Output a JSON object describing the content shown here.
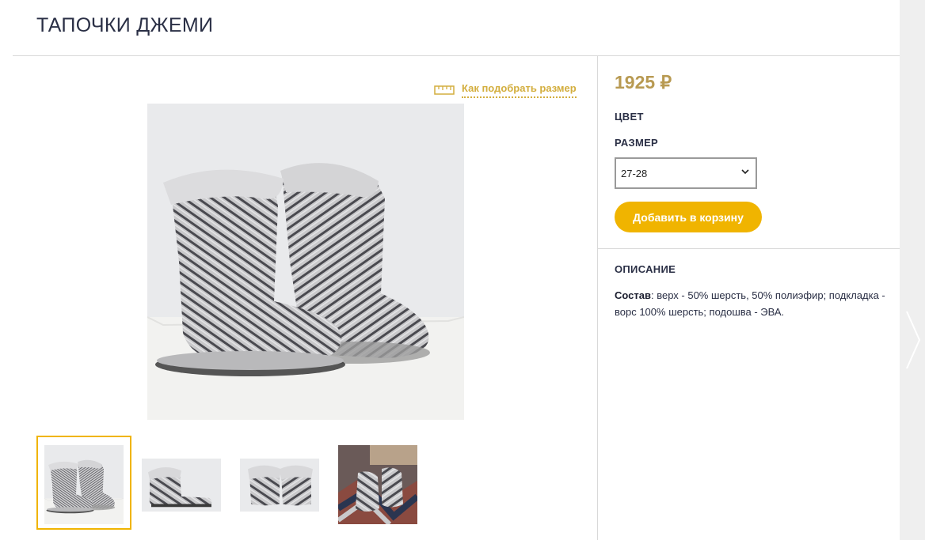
{
  "product": {
    "title": "ТАПОЧКИ ДЖЕМИ",
    "price": "1925 ₽"
  },
  "size_guide": {
    "label": "Как подобрать размер",
    "icon": "ruler-icon"
  },
  "options": {
    "color_label": "ЦВЕТ",
    "size_label": "РАЗМЕР",
    "size_selected": "27-28"
  },
  "actions": {
    "add_to_cart": "Добавить в корзину"
  },
  "description": {
    "title": "ОПИСАНИЕ",
    "composition_label": "Состав",
    "composition_text": ": верх - 50% шерсть, 50% полиэфир; подкладка - ворс 100% шерсть; подошва - ЭВА."
  },
  "gallery": {
    "thumbnail_count": 4,
    "active_index": 0
  },
  "colors": {
    "accent": "#f0b400",
    "price": "#b89a52",
    "link": "#d3ae3e",
    "text": "#2a2f45"
  }
}
